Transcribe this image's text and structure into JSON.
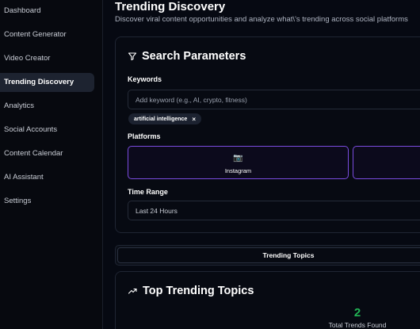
{
  "sidebar": {
    "items": [
      {
        "label": "Dashboard",
        "active": false
      },
      {
        "label": "Content Generator",
        "active": false
      },
      {
        "label": "Video Creator",
        "active": false
      },
      {
        "label": "Trending Discovery",
        "active": true
      },
      {
        "label": "Analytics",
        "active": false
      },
      {
        "label": "Social Accounts",
        "active": false
      },
      {
        "label": "Content Calendar",
        "active": false
      },
      {
        "label": "AI Assistant",
        "active": false
      },
      {
        "label": "Settings",
        "active": false
      }
    ]
  },
  "header": {
    "title": "Trending Discovery",
    "subtitle": "Discover viral content opportunities and analyze what\\'s trending across social platforms"
  },
  "search": {
    "title": "Search Parameters",
    "title_icon": "filter-icon",
    "keywords_label": "Keywords",
    "keyword_placeholder": "Add keyword (e.g., AI, crypto, fitness)",
    "keyword_chips": [
      {
        "label": "artificial intelligence",
        "remove": "×"
      }
    ],
    "platforms_label": "Platforms",
    "platforms": [
      {
        "label": "Instagram",
        "icon": "📷",
        "icon_name": "camera-icon"
      },
      {
        "label": "",
        "icon": "",
        "icon_name": ""
      }
    ],
    "time_range_label": "Time Range",
    "time_range_value": "Last 24 Hours"
  },
  "tabs": {
    "items": [
      {
        "label": "Trending Topics",
        "active": true
      }
    ]
  },
  "trending": {
    "title": "Top Trending Topics",
    "title_icon": "trending-up-icon",
    "total_value": "2",
    "total_label": "Total Trends Found",
    "accent_color": "#22b455"
  },
  "colors": {
    "accent_purple": "#7b4ce0",
    "active_nav_bg": "#1d2330"
  }
}
